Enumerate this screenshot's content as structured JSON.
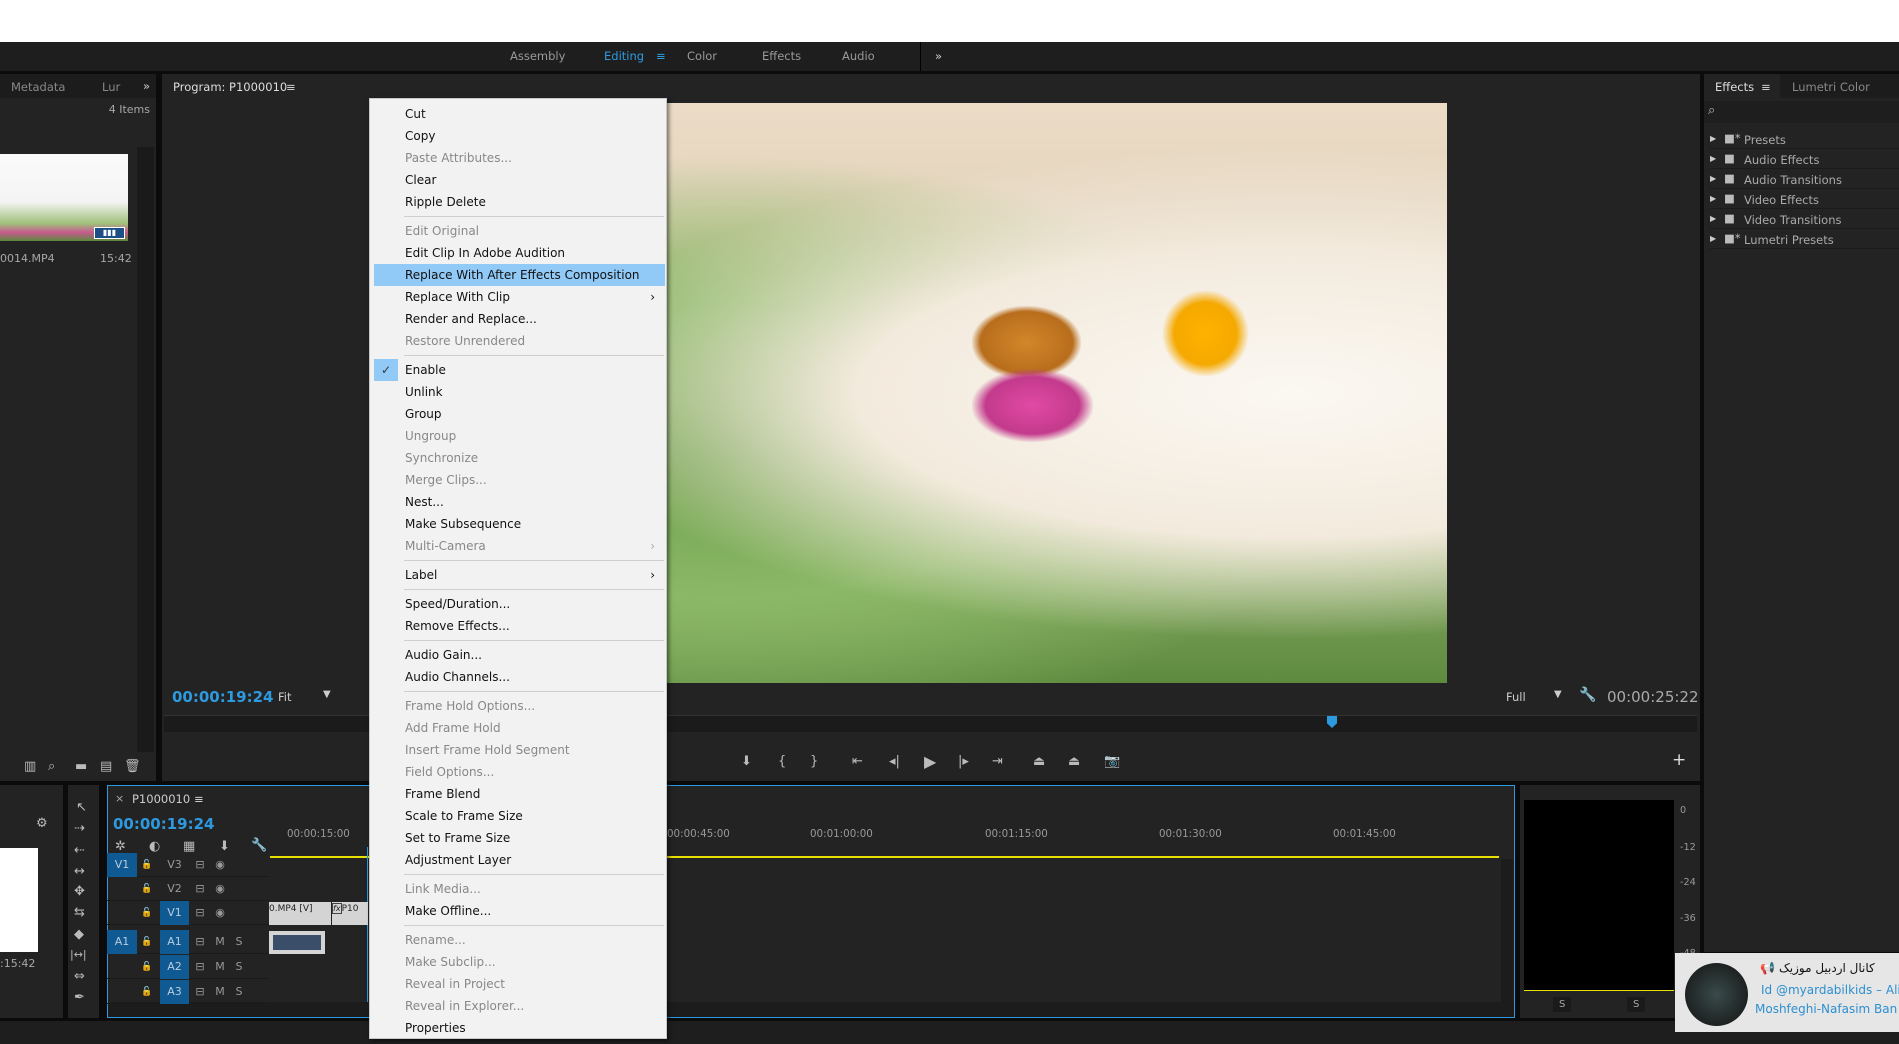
{
  "workspaces": {
    "items": [
      {
        "label": "Assembly"
      },
      {
        "label": "Editing",
        "active": true
      },
      {
        "label": "Color"
      },
      {
        "label": "Effects"
      },
      {
        "label": "Audio"
      }
    ],
    "overflow": "»",
    "menu_icon": "≡"
  },
  "project_panel": {
    "tabs": [
      "Metadata",
      "Lur"
    ],
    "overflow": "»",
    "items_count": "4 Items",
    "clip_name": "0014.MP4",
    "clip_duration": "15:42"
  },
  "program_monitor": {
    "title": "Program: P1000010",
    "menu_icon": "≡",
    "timecode": "00:00:19:24",
    "fit": "Fit",
    "quality": "Full",
    "duration": "00:00:25:22",
    "add": "+"
  },
  "context_menu": {
    "items": [
      {
        "label": "Cut"
      },
      {
        "label": "Copy"
      },
      {
        "label": "Paste Attributes...",
        "disabled": true
      },
      {
        "label": "Clear"
      },
      {
        "label": "Ripple Delete"
      },
      {
        "sep": true
      },
      {
        "label": "Edit Original",
        "disabled": true
      },
      {
        "label": "Edit Clip In Adobe Audition"
      },
      {
        "label": "Replace With After Effects Composition",
        "highlighted": true
      },
      {
        "label": "Replace With Clip",
        "submenu": true
      },
      {
        "label": "Render and Replace..."
      },
      {
        "label": "Restore Unrendered",
        "disabled": true
      },
      {
        "sep": true
      },
      {
        "label": "Enable",
        "checked": true
      },
      {
        "label": "Unlink"
      },
      {
        "label": "Group"
      },
      {
        "label": "Ungroup",
        "disabled": true
      },
      {
        "label": "Synchronize",
        "disabled": true
      },
      {
        "label": "Merge Clips...",
        "disabled": true
      },
      {
        "label": "Nest..."
      },
      {
        "label": "Make Subsequence"
      },
      {
        "label": "Multi-Camera",
        "disabled": true,
        "submenu": true
      },
      {
        "sep": true
      },
      {
        "label": "Label",
        "submenu": true
      },
      {
        "sep": true
      },
      {
        "label": "Speed/Duration..."
      },
      {
        "label": "Remove Effects..."
      },
      {
        "sep": true
      },
      {
        "label": "Audio Gain..."
      },
      {
        "label": "Audio Channels..."
      },
      {
        "sep": true
      },
      {
        "label": "Frame Hold Options...",
        "disabled": true
      },
      {
        "label": "Add Frame Hold",
        "disabled": true
      },
      {
        "label": "Insert Frame Hold Segment",
        "disabled": true
      },
      {
        "label": "Field Options...",
        "disabled": true
      },
      {
        "label": "Frame Blend"
      },
      {
        "label": "Scale to Frame Size"
      },
      {
        "label": "Set to Frame Size"
      },
      {
        "label": "Adjustment Layer"
      },
      {
        "sep": true
      },
      {
        "label": "Link Media...",
        "disabled": true
      },
      {
        "label": "Make Offline..."
      },
      {
        "sep": true
      },
      {
        "label": "Rename...",
        "disabled": true
      },
      {
        "label": "Make Subclip...",
        "disabled": true
      },
      {
        "label": "Reveal in Project",
        "disabled": true
      },
      {
        "label": "Reveal in Explorer...",
        "disabled": true
      },
      {
        "label": "Properties"
      }
    ]
  },
  "effects_panel": {
    "tabs": [
      "Effects",
      "Lumetri Color"
    ],
    "menu_icon": "≡",
    "items": [
      {
        "label": "Presets",
        "icon": "star-folder"
      },
      {
        "label": "Audio Effects",
        "icon": "folder"
      },
      {
        "label": "Audio Transitions",
        "icon": "folder"
      },
      {
        "label": "Video Effects",
        "icon": "folder"
      },
      {
        "label": "Video Transitions",
        "icon": "folder"
      },
      {
        "label": "Lumetri Presets",
        "icon": "star-folder"
      }
    ]
  },
  "timeline": {
    "title": "P1000010",
    "close": "×",
    "menu_icon": "≡",
    "timecode": "00:00:19:24",
    "ruler": [
      "00:00:15:00",
      "00:00:45:00",
      "00:01:00:00",
      "00:01:15:00",
      "00:01:30:00",
      "00:01:45:00"
    ],
    "tracks": [
      {
        "src": "V1",
        "name": "V3",
        "m": "",
        "s": ""
      },
      {
        "src": "",
        "name": "V2",
        "m": "",
        "s": ""
      },
      {
        "src": "",
        "name": "V1",
        "m": "",
        "s": "",
        "target": true
      },
      {
        "src": "A1",
        "name": "A1",
        "m": "M",
        "s": "S",
        "target": true
      },
      {
        "src": "",
        "name": "A2",
        "m": "M",
        "s": "S",
        "target": true
      },
      {
        "src": "",
        "name": "A3",
        "m": "M",
        "s": "S",
        "target": true
      }
    ],
    "clip_video": "0.MP4 [V]",
    "clip_video2": "P10",
    "fx": "fx"
  },
  "source_mini": {
    "duration": ":15:42"
  },
  "audio_meter": {
    "scale": [
      "0",
      "-12",
      "-24",
      "-36",
      "-48"
    ],
    "solo": [
      "S",
      "S"
    ]
  },
  "overlay": {
    "channel": "کانال اردبیل موزیک",
    "line1": "Id @myardabilkids – Ali",
    "line2": "Moshfeghi-Nafasim Ban"
  },
  "colors": {
    "accent": "#2d9ae0",
    "highlight": "#91c9f7",
    "playhead": "#2d9ae0"
  }
}
